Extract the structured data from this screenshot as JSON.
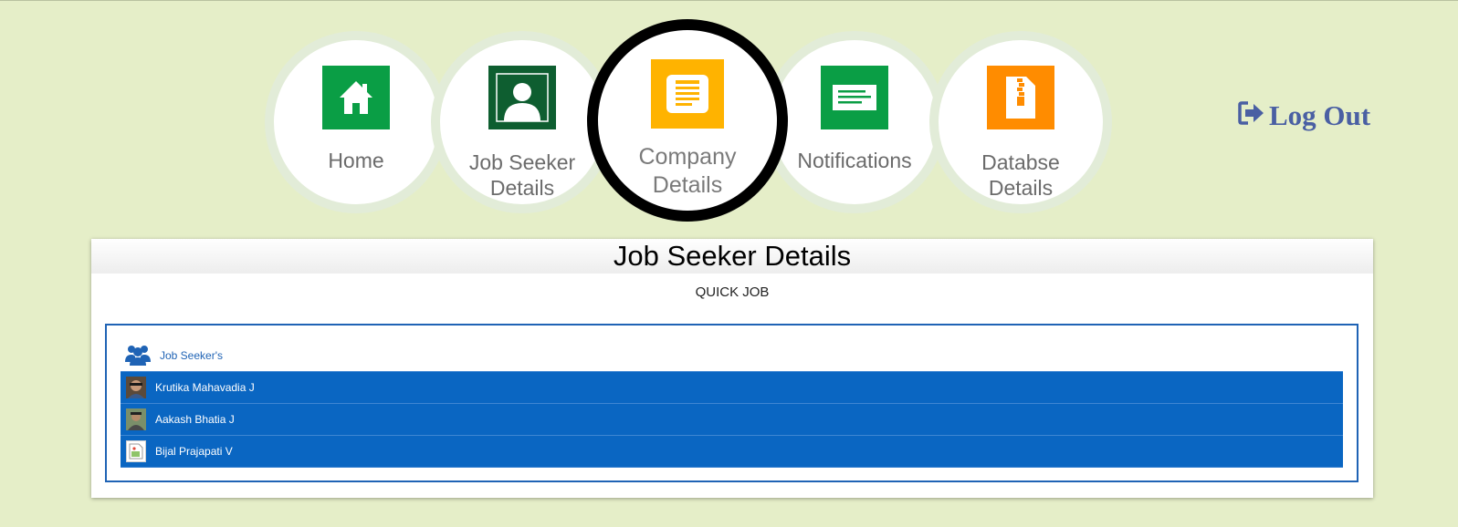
{
  "nav": {
    "items": [
      {
        "label": "Home",
        "icon": "home-icon",
        "color": "#0a9e45"
      },
      {
        "label": "Job Seeker\nDetails",
        "icon": "user-icon",
        "color": "#0e5e30"
      },
      {
        "label": "Company\nDetails",
        "icon": "document-icon",
        "color": "#ffb300",
        "active": true
      },
      {
        "label": "Notifications",
        "icon": "message-icon",
        "color": "#0a9e45"
      },
      {
        "label": "Databse\nDetails",
        "icon": "archive-icon",
        "color": "#ff8c00"
      }
    ]
  },
  "logout": {
    "label": "Log Out",
    "icon": "sign-out-icon",
    "color": "#4a5fa3"
  },
  "panel": {
    "title": "Job Seeker Details",
    "subtitle": "QUICK JOB",
    "list_title": "Job Seeker's",
    "list_icon": "users-icon",
    "seekers": [
      {
        "name": "Krutika Mahavadia J",
        "avatar": "photo"
      },
      {
        "name": "Aakash Bhatia J",
        "avatar": "photo"
      },
      {
        "name": "Bijal Prajapati V",
        "avatar": "broken-image"
      }
    ]
  }
}
